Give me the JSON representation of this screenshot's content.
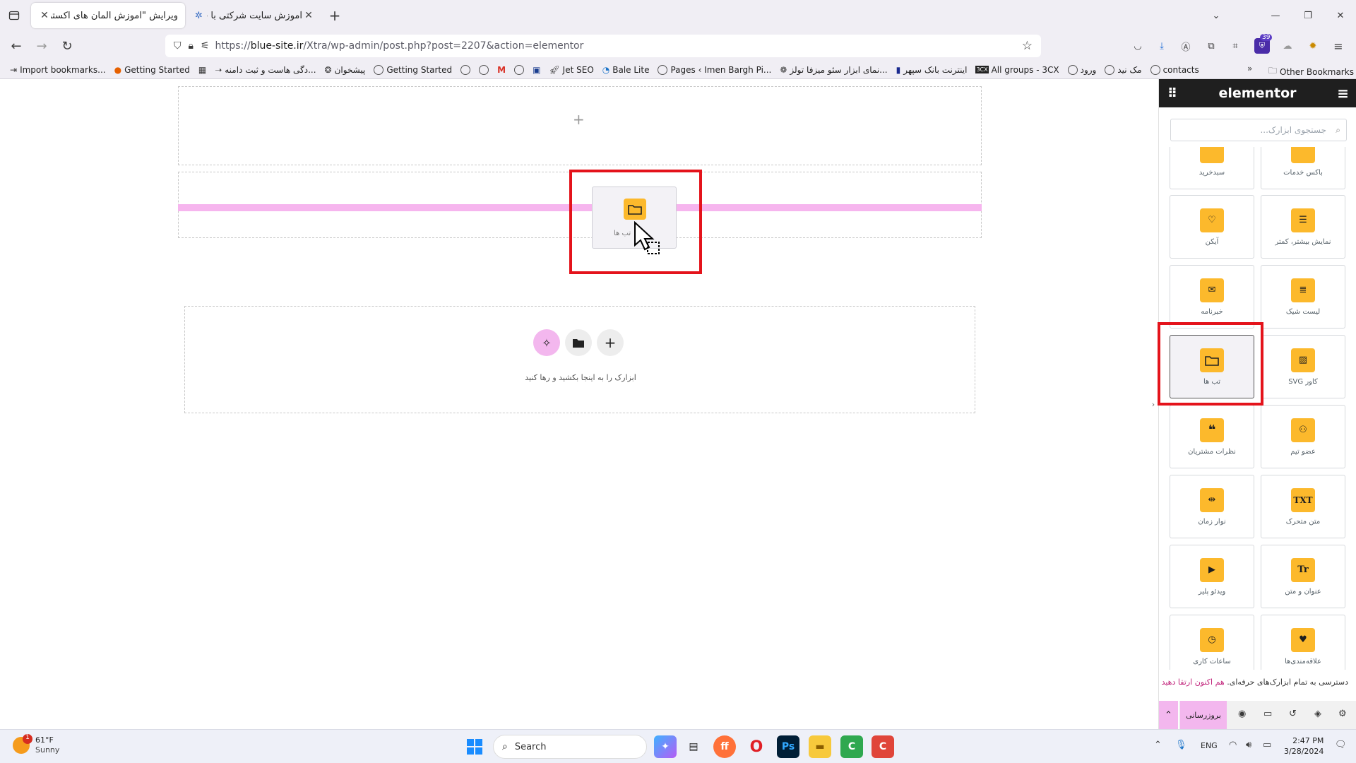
{
  "tabs": [
    {
      "title": "ویرایش \"آموزش المان های اکسترا – ...",
      "active": true
    },
    {
      "title": "آموزش سایت شرکتی با قالب اکس...",
      "active": false
    }
  ],
  "nav": {
    "url_prefix": "https://",
    "url_host": "blue-site.ir",
    "url_path": "/Xtra/wp-admin/post.php?post=2207&action=elementor",
    "notification_count": "39"
  },
  "bookmarks": [
    "Import bookmarks...",
    "Getting Started",
    "...دگی هاست و ثبت دامنه",
    "پیشخوان",
    "Getting Started",
    "Jet SEO",
    "Bale Lite",
    "Pages ‹ Imen Bargh Pi...",
    "...نمای ابزار سئو میزفا تولز",
    "اینترنت بانک سپهر",
    "All groups - 3CX",
    "ورود",
    "مک نید",
    "contacts"
  ],
  "other_bookmarks": "Other Bookmarks",
  "canvas": {
    "add_section_plus": "+",
    "drag_ghost_label": "تب ها",
    "drop_hint": "ابزارک را به اینجا بکشید و رها کنید",
    "drop_plus": "+"
  },
  "panel": {
    "logo": "elementor",
    "search_placeholder": "جستجوی ابزارک...",
    "widgets": [
      {
        "label": "باکس خدمات",
        "icon": "services-box-icon"
      },
      {
        "label": "سبدخرید",
        "icon": "cart-icon"
      },
      {
        "label": "نمایش بیشتر، کمتر",
        "icon": "read-more-icon"
      },
      {
        "label": "آیکن",
        "icon": "heart-icon"
      },
      {
        "label": "لیست شیک",
        "icon": "list-icon"
      },
      {
        "label": "خبرنامه",
        "icon": "envelope-icon"
      },
      {
        "label": "کاور SVG",
        "icon": "svg-cover-icon"
      },
      {
        "label": "تب ها",
        "icon": "folder-icon"
      },
      {
        "label": "عضو تیم",
        "icon": "team-icon"
      },
      {
        "label": "نظرات مشتریان",
        "icon": "quote-icon"
      },
      {
        "label": "متن متحرک",
        "icon": "txt-icon"
      },
      {
        "label": "نوار زمان",
        "icon": "timeline-icon"
      },
      {
        "label": "عنوان و متن",
        "icon": "heading-icon"
      },
      {
        "label": "ویدئو پلیر",
        "icon": "video-icon"
      },
      {
        "label": "علاقه‌مندی‌ها",
        "icon": "heart-badge-icon"
      },
      {
        "label": "ساعات کاری",
        "icon": "clock-icon"
      }
    ],
    "promo_text": "دسترسی به تمام ابزارک‌های حرفه‌ای.",
    "promo_link": "هم اکنون ارتقا دهید",
    "update_button": "بروزرسانی"
  },
  "taskbar": {
    "weather_temp": "61°F",
    "weather_desc": "Sunny",
    "weather_badge": "1",
    "search_label": "Search",
    "lang": "ENG",
    "time": "2:47 PM",
    "date": "3/28/2024"
  },
  "colors": {
    "accent_yellow": "#fcb92c",
    "highlight_red": "#e4131b",
    "drop_line": "#f6b5ee",
    "panel_header": "#1f1f1f"
  }
}
